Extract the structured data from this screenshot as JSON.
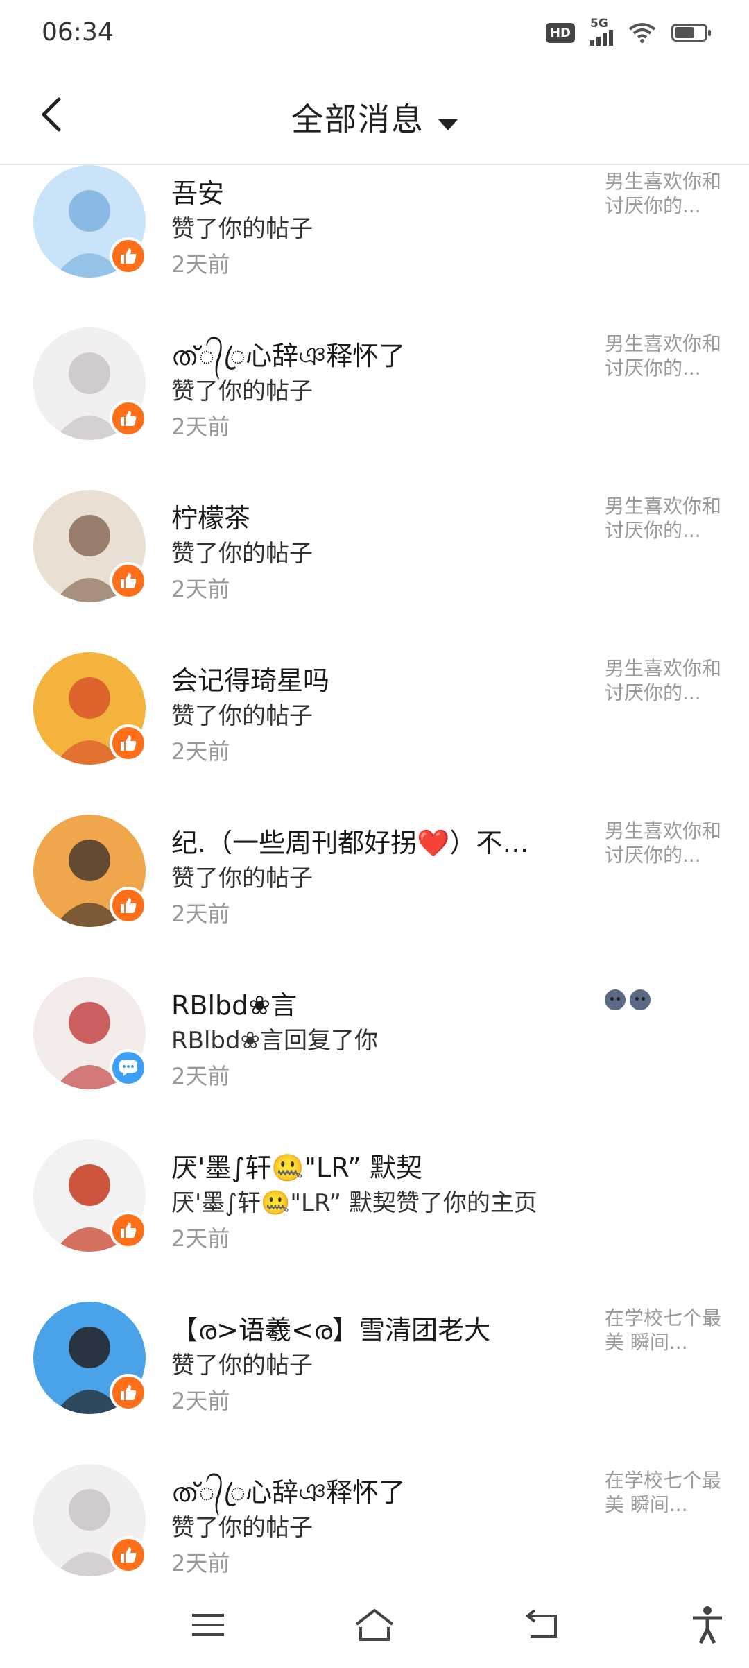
{
  "status_bar": {
    "time": "06:34",
    "hd": "HD",
    "network": "5G",
    "icons": [
      "hd-icon",
      "signal-icon",
      "wifi-icon",
      "battery-icon"
    ]
  },
  "header": {
    "title": "全部消息",
    "back_icon": "chevron-left-icon",
    "dropdown_icon": "caret-down-icon"
  },
  "colors": {
    "like_badge": "#ff6f1a",
    "comment_badge": "#3d9ff5",
    "divider": "#e4e4e4",
    "time_text": "#999999"
  },
  "messages": [
    {
      "name": "吾安",
      "action": "赞了你的帖子",
      "time": "2天前",
      "preview": "男生喜欢你和讨厌你的...",
      "badge": "like-icon"
    },
    {
      "name": "ത്᭄ꦿ心辞ঞ释怀了",
      "action": "赞了你的帖子",
      "time": "2天前",
      "preview": "男生喜欢你和讨厌你的...",
      "badge": "like-icon"
    },
    {
      "name": "柠檬茶",
      "action": "赞了你的帖子",
      "time": "2天前",
      "preview": "男生喜欢你和讨厌你的...",
      "badge": "like-icon"
    },
    {
      "name": "会记得琦星吗",
      "action": "赞了你的帖子",
      "time": "2天前",
      "preview": "男生喜欢你和讨厌你的...",
      "badge": "like-icon"
    },
    {
      "name": "纪.（一些周刊都好拐❤️）不…",
      "action": "赞了你的帖子",
      "time": "2天前",
      "preview": "男生喜欢你和讨厌你的...",
      "badge": "like-icon"
    },
    {
      "name": "RBlbd❀言",
      "action": "RBlbd❀言回复了你",
      "time": "2天前",
      "preview": "",
      "preview_emoji": "new-moon-face-emoji",
      "badge": "comment-icon"
    },
    {
      "name": "厌'墨∫轩🤐\"LR” 默契",
      "action": "厌'墨∫轩🤐\"LR” 默契赞了你的主页",
      "time": "2天前",
      "preview": "",
      "badge": "like-icon"
    },
    {
      "name": "【ര>语羲<ര】雪清团老大",
      "action": "赞了你的帖子",
      "time": "2天前",
      "preview": "在学校七个最美 瞬间...",
      "badge": "like-icon"
    },
    {
      "name": "ത്᭄ꦿ心辞ঞ释怀了",
      "action": "赞了你的帖子",
      "time": "2天前",
      "preview": "在学校七个最美 瞬间...",
      "badge": "like-icon"
    }
  ],
  "nav_bar": {
    "icons": [
      "menu-icon",
      "home-icon",
      "back-icon",
      "accessibility-icon"
    ]
  }
}
